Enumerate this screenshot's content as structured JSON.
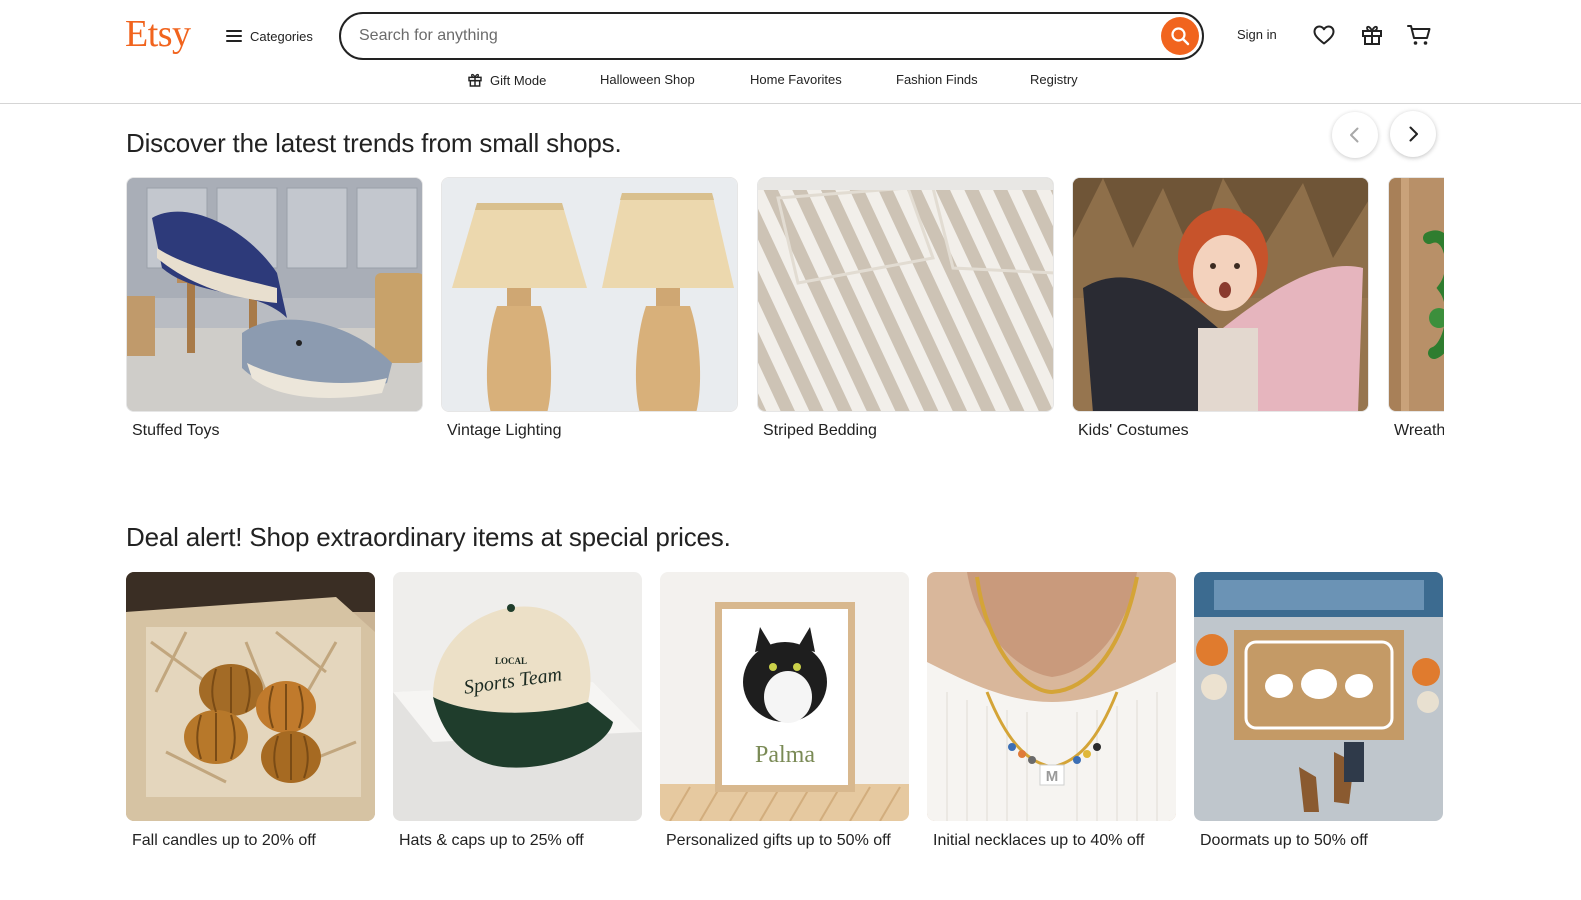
{
  "header": {
    "logo": "Etsy",
    "categories_label": "Categories",
    "search_placeholder": "Search for anything",
    "signin_label": "Sign in"
  },
  "subnav": [
    {
      "label": "Gift Mode",
      "icon": "gift-icon"
    },
    {
      "label": "Halloween Shop"
    },
    {
      "label": "Home Favorites"
    },
    {
      "label": "Fashion Finds"
    },
    {
      "label": "Registry"
    }
  ],
  "trends": {
    "title": "Discover the latest trends from small shops.",
    "items": [
      {
        "label": "Stuffed Toys"
      },
      {
        "label": "Vintage Lighting"
      },
      {
        "label": "Striped Bedding"
      },
      {
        "label": "Kids' Costumes"
      },
      {
        "label": "Wreaths"
      }
    ]
  },
  "deals": {
    "title": "Deal alert! Shop extraordinary items at special prices.",
    "items": [
      {
        "label": "Fall candles up to 20% off"
      },
      {
        "label": "Hats & caps up to 25% off"
      },
      {
        "label": "Personalized gifts up to 50% off"
      },
      {
        "label": "Initial necklaces up to 40% off"
      },
      {
        "label": "Doormats up to 50% off"
      }
    ]
  },
  "product_art": {
    "cap_text_small": "LOCAL",
    "cap_text": "Sports Team",
    "print_name": "Palma",
    "necklace_initial": "M"
  },
  "colors": {
    "brand": "#f1641e",
    "text": "#222222"
  }
}
